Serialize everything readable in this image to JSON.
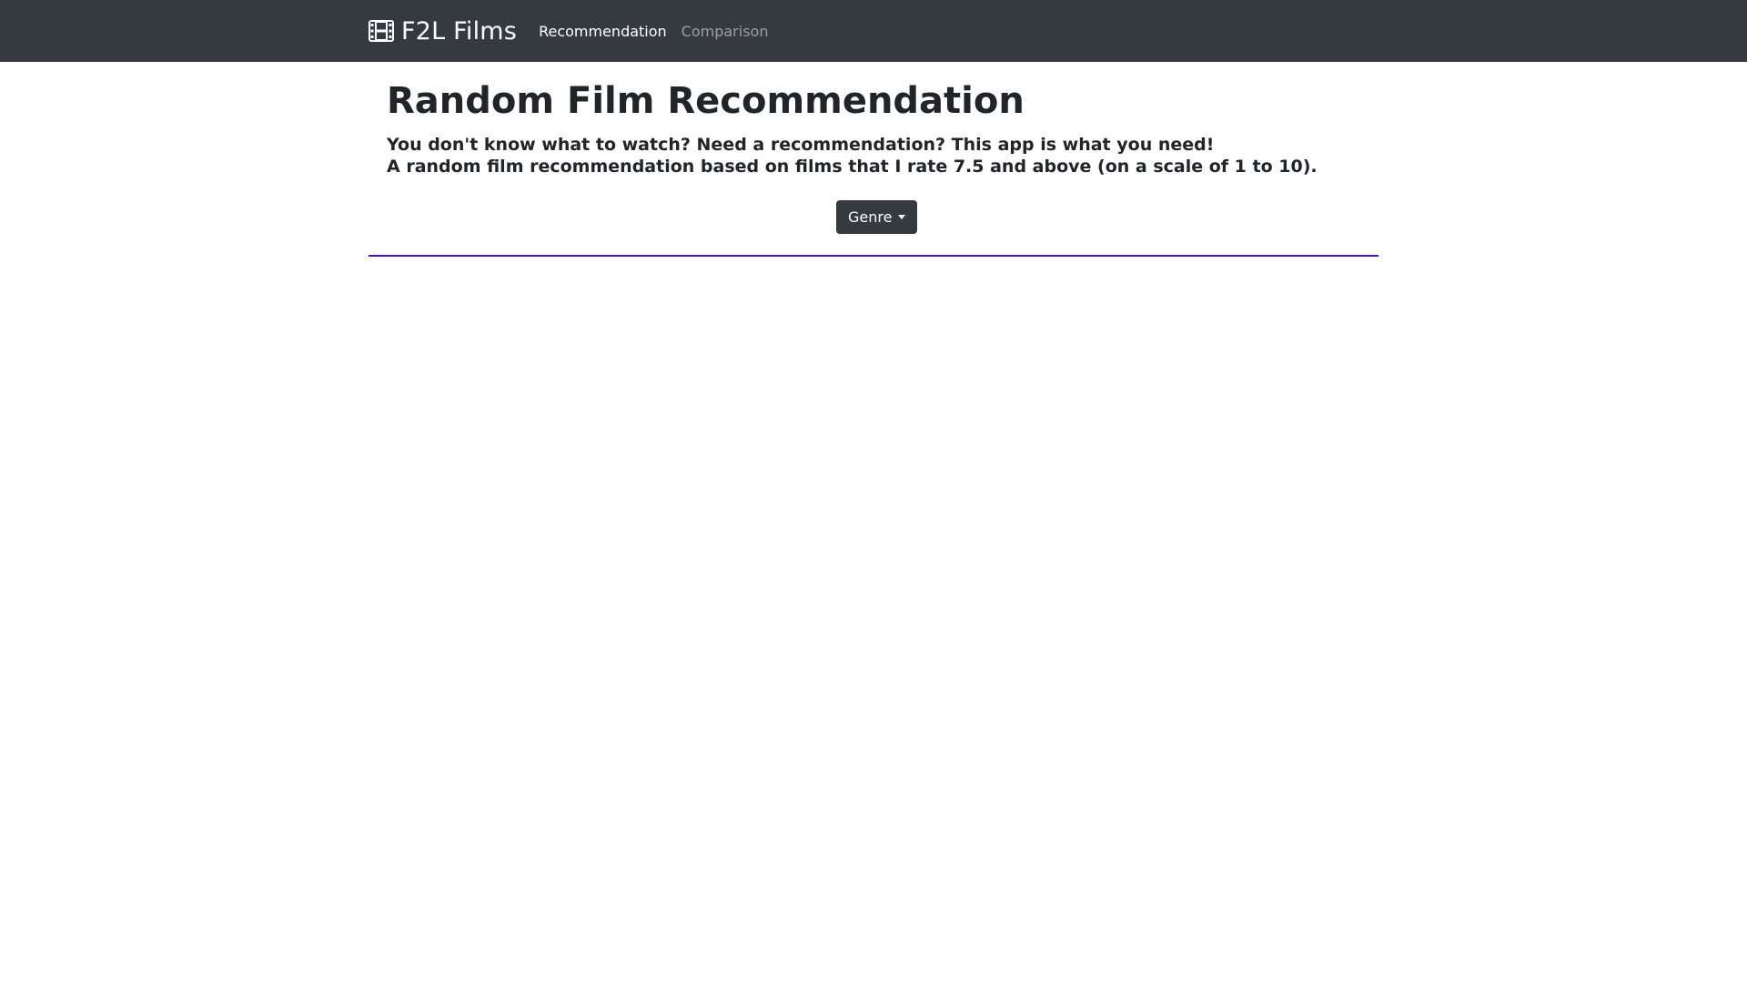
{
  "navbar": {
    "brand": {
      "icon": "film-icon",
      "label": "F2L Films"
    },
    "links": [
      {
        "label": "Recommendation",
        "active": true
      },
      {
        "label": "Comparison",
        "active": false
      }
    ]
  },
  "main": {
    "title": "Random Film Recommendation",
    "lead_lines": [
      "You don't know what to watch? Need a recommendation? This app is what you need!",
      "A random film recommendation based on films that I rate 7.5 and above (on a scale of 1 to 10)."
    ],
    "genre_dropdown": {
      "label": "Genre",
      "icon": "caret-down-icon"
    }
  },
  "colors": {
    "navbar_bg": "#343a40",
    "button_bg": "#343a40",
    "divider": "#4b0fc9",
    "text": "#212529"
  }
}
